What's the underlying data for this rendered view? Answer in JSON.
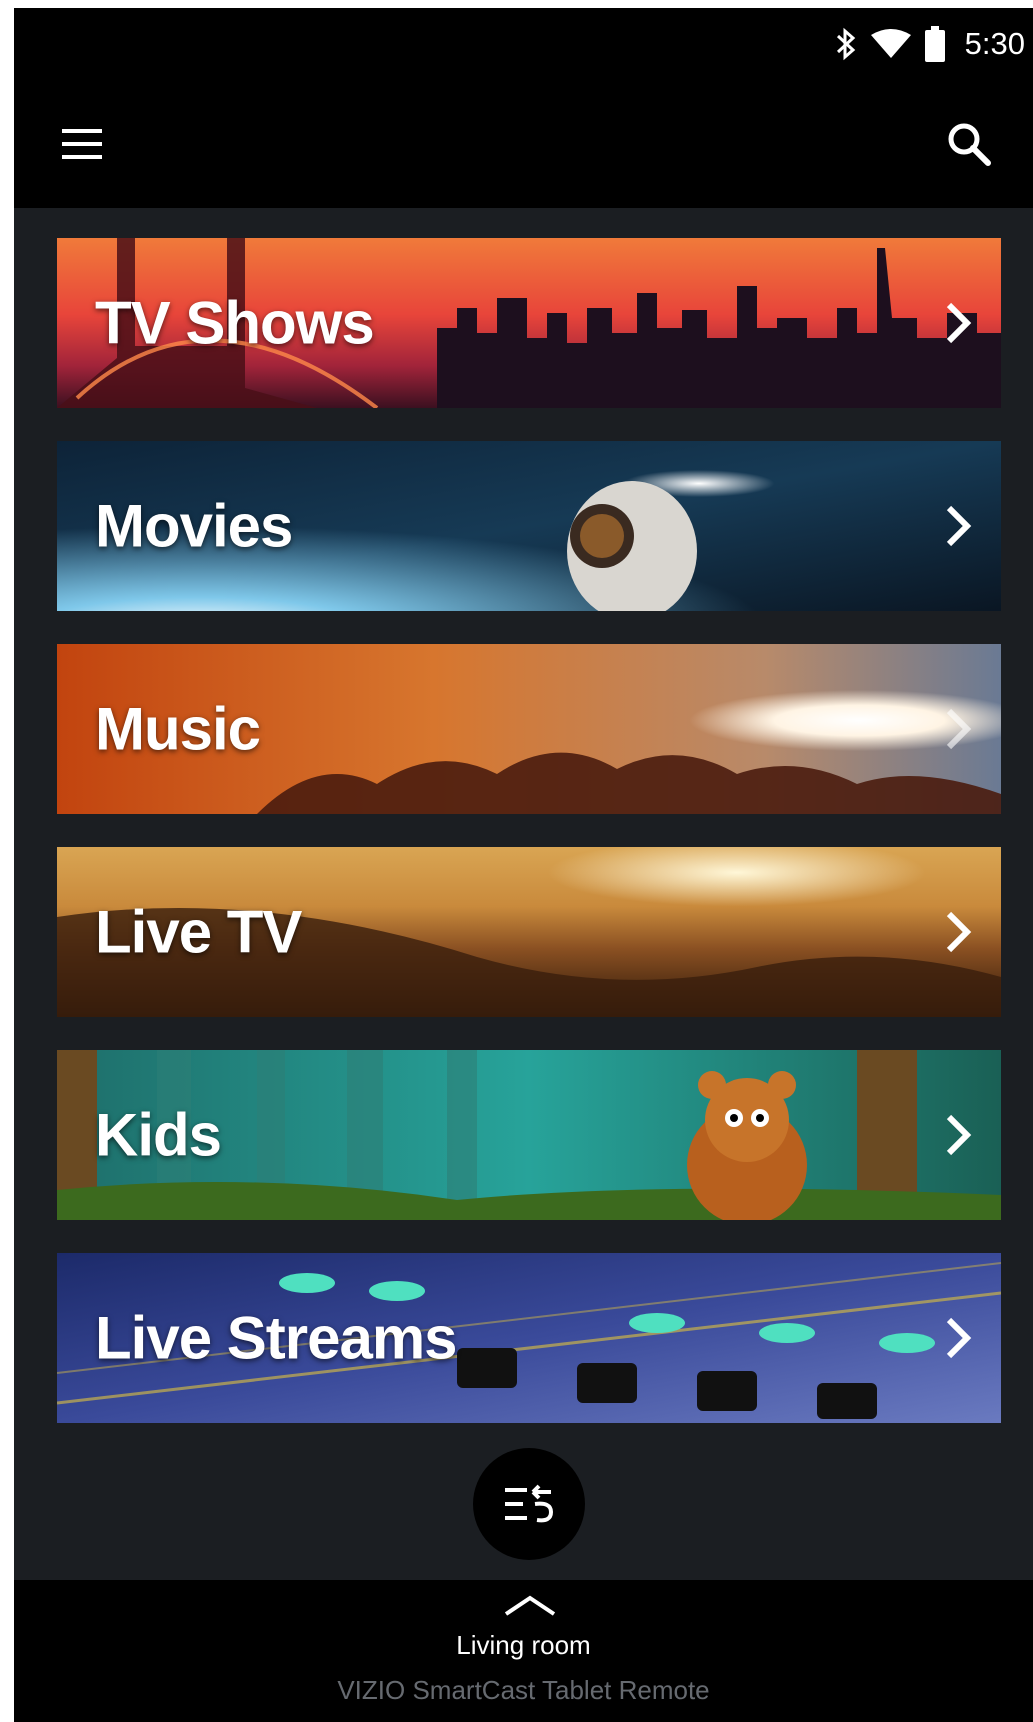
{
  "status_bar": {
    "time": "5:30",
    "icons": [
      "bluetooth-icon",
      "wifi-icon",
      "battery-icon"
    ]
  },
  "app_bar": {
    "menu_icon": "hamburger-menu-icon",
    "search_icon": "search-icon"
  },
  "categories": [
    {
      "label": "TV Shows"
    },
    {
      "label": "Movies"
    },
    {
      "label": "Music"
    },
    {
      "label": "Live TV"
    },
    {
      "label": "Kids"
    },
    {
      "label": "Live Streams"
    }
  ],
  "fab": {
    "icon": "queue-return-icon"
  },
  "bottom_sheet": {
    "expand_icon": "chevron-up-icon",
    "room": "Living room",
    "app_name": "VIZIO SmartCast Tablet Remote"
  },
  "colors": {
    "background": "#1b1e22",
    "bars": "#000000",
    "text": "#ffffff",
    "muted_text": "#666a70"
  }
}
